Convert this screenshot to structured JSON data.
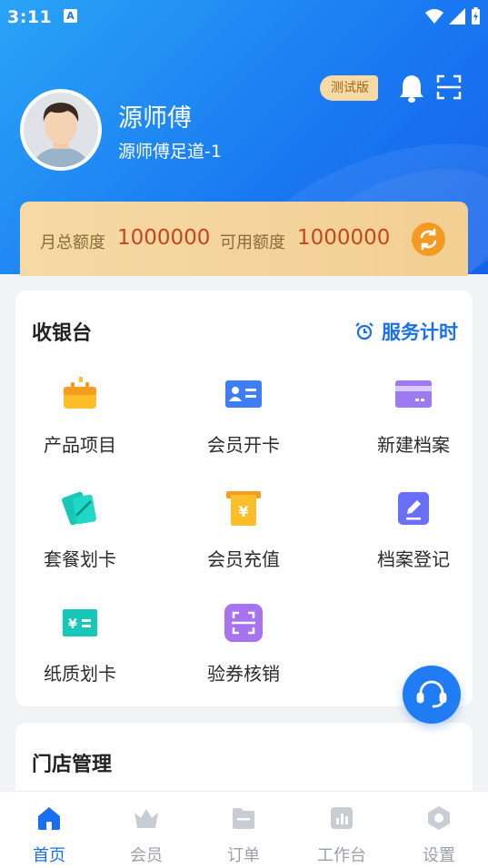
{
  "status_bar": {
    "time": "3:11",
    "notification_icon": "A"
  },
  "profile": {
    "name": "源师傅",
    "shop": "源师傅足道-1",
    "badge": "测试版"
  },
  "quota": {
    "monthly_label": "月总额度",
    "monthly_value": "1000000",
    "available_label": "可用额度",
    "available_value": "1000000"
  },
  "cashier": {
    "title": "收银台",
    "timer_label": "服务计时",
    "items": [
      {
        "label": "产品项目",
        "icon": "basket-icon"
      },
      {
        "label": "会员开卡",
        "icon": "member-card-icon"
      },
      {
        "label": "新建档案",
        "icon": "card-icon"
      },
      {
        "label": "套餐划卡",
        "icon": "package-card-icon"
      },
      {
        "label": "会员充值",
        "icon": "recharge-icon"
      },
      {
        "label": "档案登记",
        "icon": "edit-record-icon"
      },
      {
        "label": "纸质划卡",
        "icon": "paper-ticket-icon"
      },
      {
        "label": "验券核销",
        "icon": "scan-coupon-icon"
      }
    ]
  },
  "store": {
    "title": "门店管理"
  },
  "tabs": [
    {
      "label": "首页",
      "icon": "home-icon",
      "active": true
    },
    {
      "label": "会员",
      "icon": "crown-icon",
      "active": false
    },
    {
      "label": "订单",
      "icon": "order-icon",
      "active": false
    },
    {
      "label": "工作台",
      "icon": "chart-icon",
      "active": false
    },
    {
      "label": "设置",
      "icon": "settings-icon",
      "active": false
    }
  ],
  "colors": {
    "primary": "#1a6ff0",
    "quota_value": "#c4461d",
    "refresh": "#f39a22"
  }
}
